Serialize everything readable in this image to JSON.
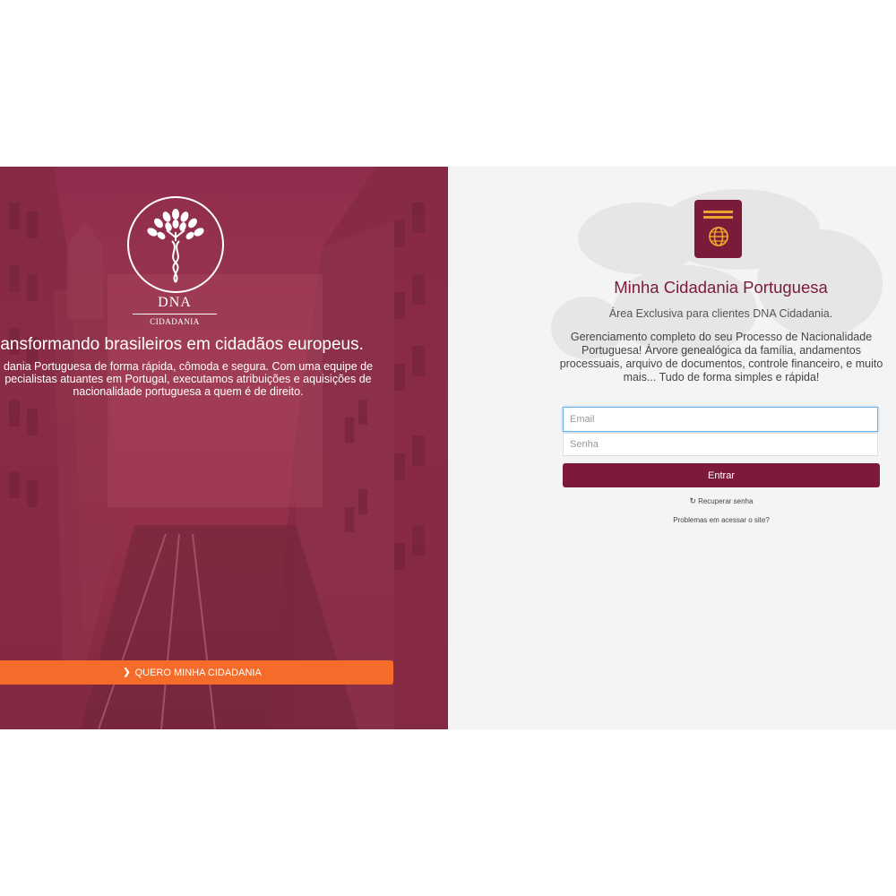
{
  "hero": {
    "logo_main": "DNA",
    "logo_sub": "CIDADANIA",
    "title": "ransformando brasileiros em cidadãos europeus.",
    "description": "dania Portuguesa de forma rápida, cômoda e segura. Com uma equipe de pecialistas atuantes em Portugal, executamos atribuições e aquisições de nacionalidade portuguesa a quem é de direito.",
    "cta_label": "QUERO MINHA CIDADANIA",
    "cta_icon": "chevron-right-icon",
    "cta_color": "#f56b2a"
  },
  "login": {
    "icon": "passport-icon",
    "title": "Minha Cidadania Portuguesa",
    "subtitle": "Área Exclusiva para clientes DNA Cidadania.",
    "description": "Gerenciamento completo do seu Processo de Nacionalidade Portuguesa! Árvore genealógica da família, andamentos processuais, arquivo de documentos, controle financeiro, e muito mais... Tudo de forma simples e rápida!",
    "email_placeholder": "Email",
    "password_placeholder": "Senha",
    "submit_label": "Entrar",
    "recover_label": "Recuperar senha",
    "recover_icon": "refresh-icon",
    "problems_label": "Problemas em acessar o site?",
    "accent_color": "#7d1a3a"
  }
}
